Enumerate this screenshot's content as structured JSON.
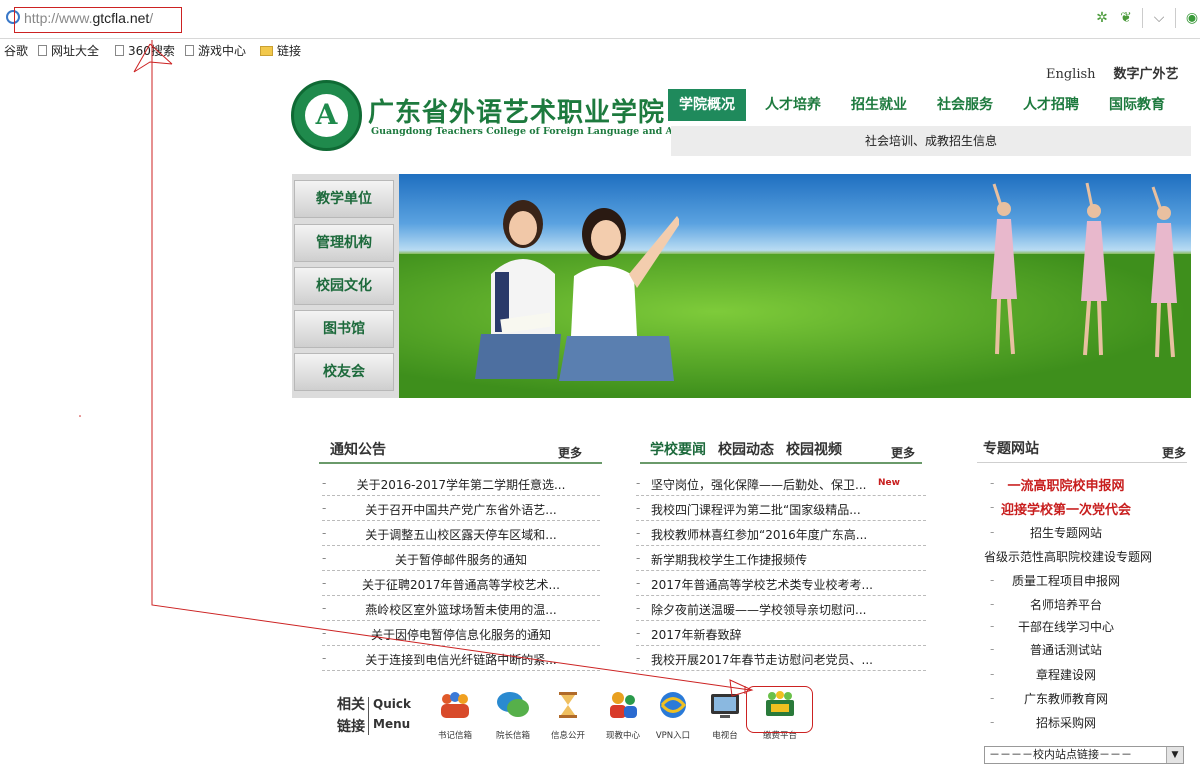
{
  "browser": {
    "url_prefix": "http://www.",
    "url_domain": "gtcfla.net",
    "url_suffix": "/",
    "bookmarks": [
      {
        "label": "谷歌",
        "icon": "none"
      },
      {
        "label": "网址大全",
        "icon": "page-icon"
      },
      {
        "label": "360搜索",
        "icon": "page-icon"
      },
      {
        "label": "游戏中心",
        "icon": "page-icon"
      },
      {
        "label": "链接",
        "icon": "folder-icon"
      }
    ]
  },
  "site": {
    "top_links": [
      "English",
      "数字广外艺"
    ],
    "logo_letter": "A",
    "name_cn": "广东省外语艺术职业学院",
    "name_en": "Guangdong Teachers College of Foreign Language and Arts",
    "main_nav": [
      "学院概况",
      "人才培养",
      "招生就业",
      "社会服务",
      "人才招聘",
      "国际教育"
    ],
    "active_nav": 0,
    "sub_nav": "社会培训、成教招生信息",
    "side_menu": [
      "教学单位",
      "管理机构",
      "校园文化",
      "图书馆",
      "校友会"
    ]
  },
  "notices": {
    "title": "通知公告",
    "more": "更多",
    "items": [
      "关于2016-2017学年第二学期任意选...",
      "关于召开中国共产党广东省外语艺...",
      "关于调整五山校区露天停车区域和...",
      "关于暂停邮件服务的通知",
      "关于征聘2017年普通高等学校艺术...",
      "燕岭校区室外篮球场暂未使用的温...",
      "关于因停电暂停信息化服务的通知",
      "关于连接到电信光纤链路中断的紧..."
    ]
  },
  "news": {
    "tabs": [
      "学校要闻",
      "校园动态",
      "校园视频"
    ],
    "more": "更多",
    "new_tag": "New",
    "items": [
      "坚守岗位，强化保障——后勤处、保卫...",
      "我校四门课程评为第二批“国家级精品...",
      "我校教师林喜红参加“2016年度广东高...",
      "新学期我校学生工作捷报频传",
      "2017年普通高等学校艺术类专业校考考...",
      "除夕夜前送温暖——学校领导亲切慰问...",
      "2017年新春致辞",
      "我校开展2017年春节走访慰问老党员、..."
    ]
  },
  "special": {
    "title": "专题网站",
    "more": "更多",
    "items": [
      "一流高职院校申报网",
      "迎接学校第一次党代会",
      "招生专题网站",
      "省级示范性高职院校建设专题网",
      "质量工程项目申报网",
      "名师培养平台",
      "干部在线学习中心",
      "普通话测试站",
      "章程建设网",
      "广东教师教育网",
      "招标采购网"
    ],
    "select_value": "－－－－校内站点链接－－－"
  },
  "quick": {
    "label_cn": "相关链接",
    "label_en_1": "Quick",
    "label_en_2": "Menu",
    "items": [
      "书记信箱",
      "院长信箱",
      "信息公开",
      "现教中心",
      "VPN入口",
      "电视台",
      "缴费平台"
    ]
  },
  "colors": {
    "brand_green": "#1d7a3e",
    "nav_active": "#1f8a5c",
    "highlight_red": "#c81e1e",
    "annotation_red": "#cc2222"
  }
}
